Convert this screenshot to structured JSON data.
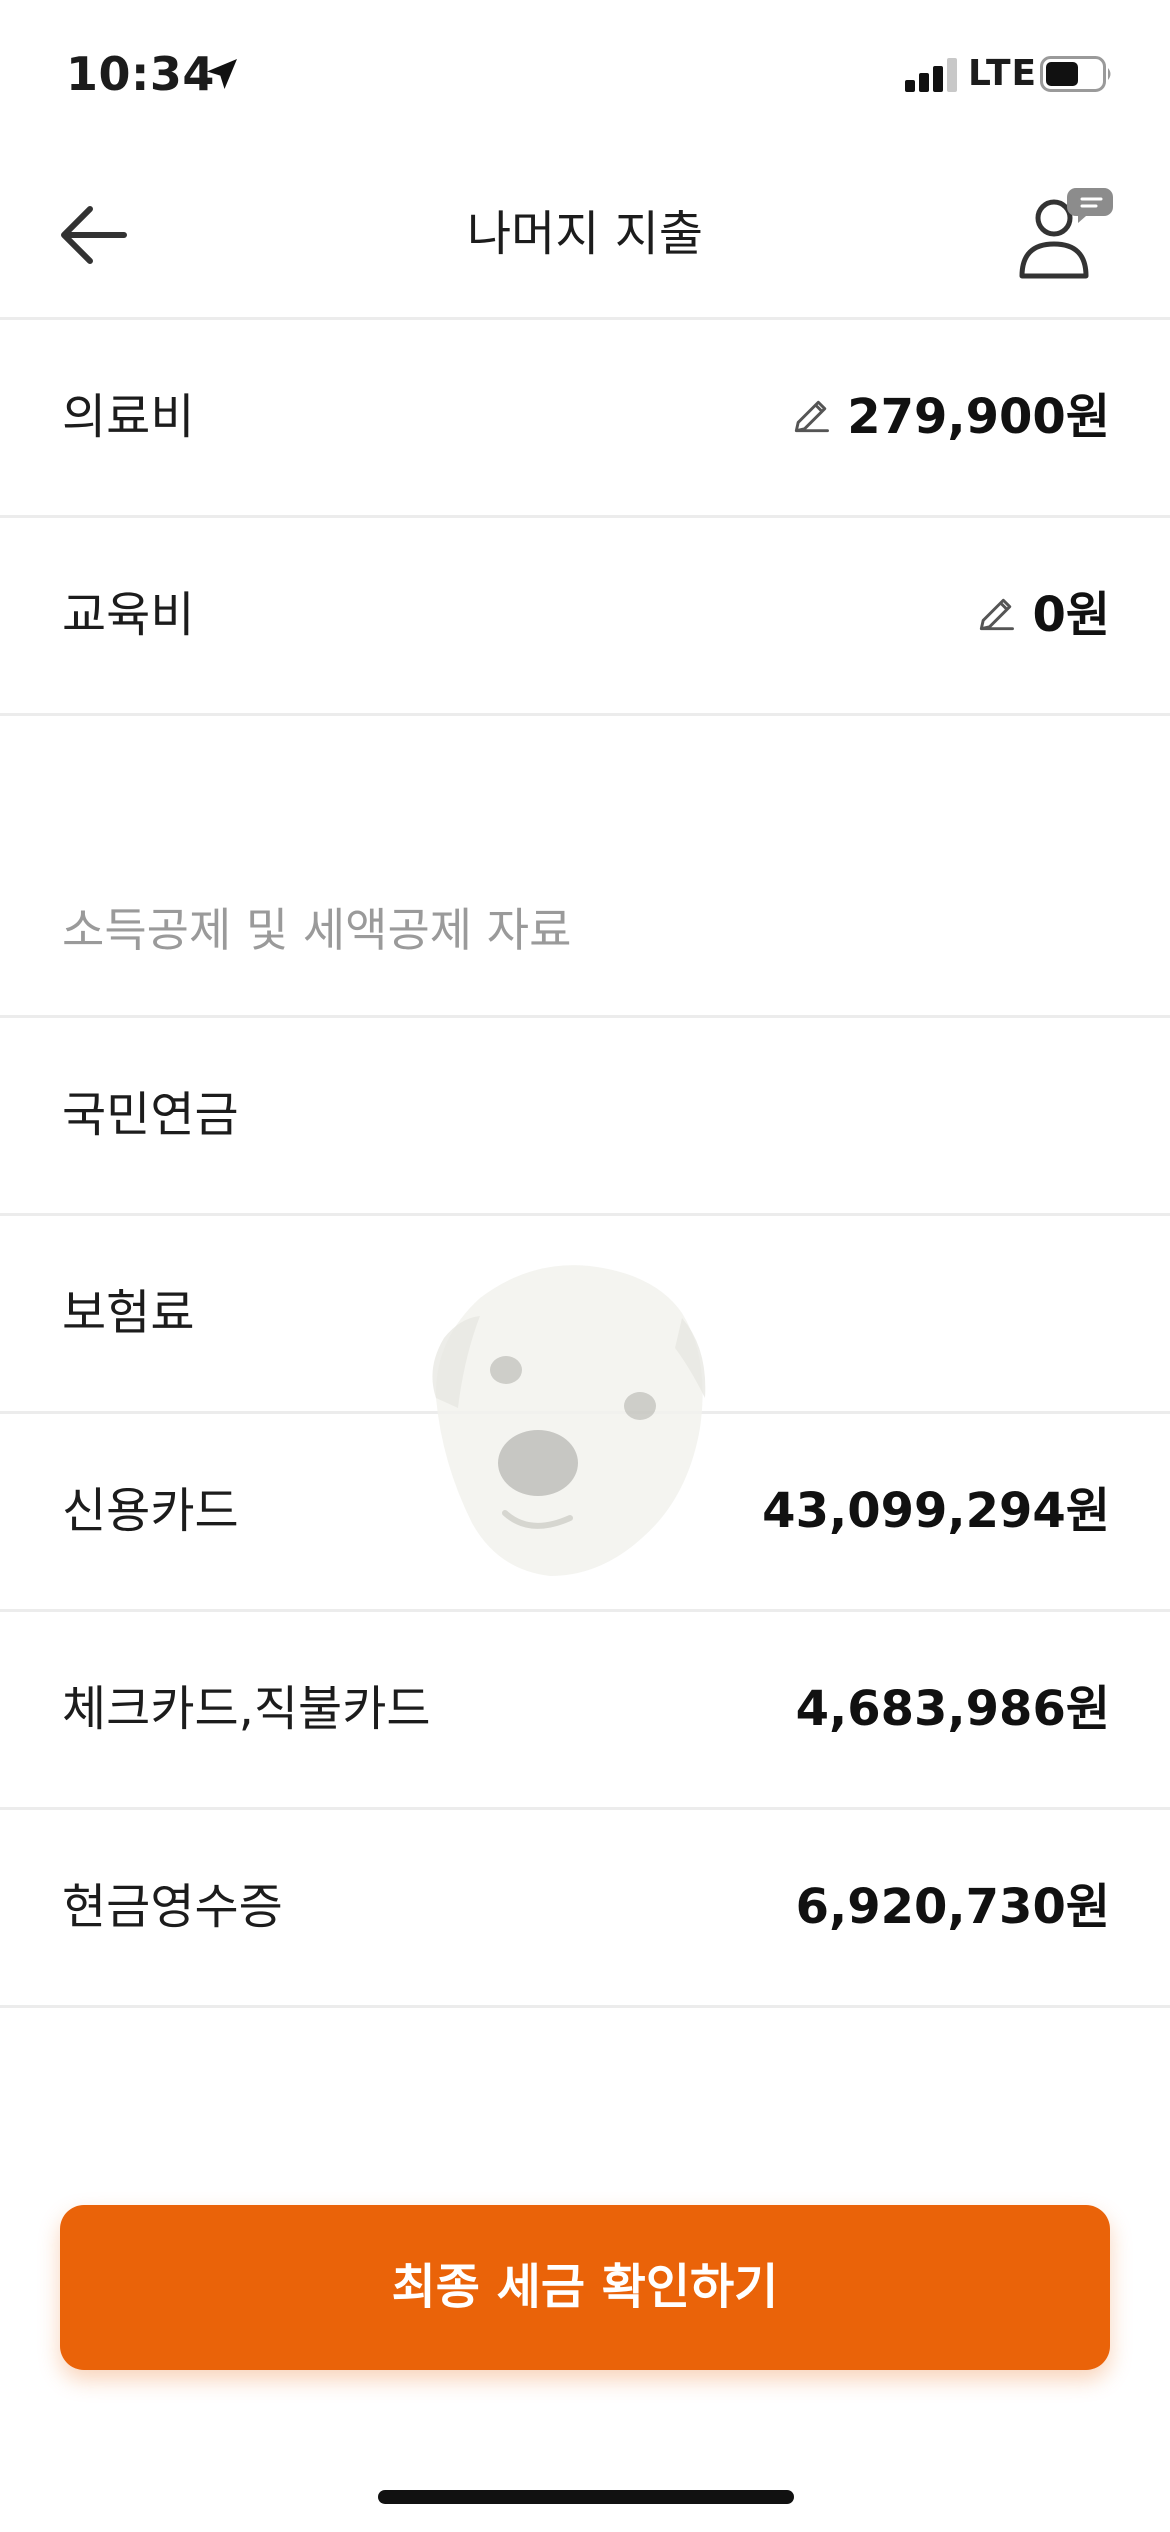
{
  "status_bar": {
    "time": "10:34",
    "network": "LTE",
    "location_icon": "location-arrow-icon",
    "signal_icon": "cellular-signal-icon",
    "battery_icon": "battery-icon"
  },
  "header": {
    "title": "나머지 지출",
    "back_icon": "arrow-left-icon",
    "profile_icon": "user-chat-icon"
  },
  "expense_rows": [
    {
      "label": "의료비",
      "value": "279,900원",
      "editable": true,
      "edit_icon": "pencil-icon"
    },
    {
      "label": "교육비",
      "value": "0원",
      "editable": true,
      "edit_icon": "pencil-icon"
    }
  ],
  "deduction_section": {
    "heading": "소득공제 및 세액공제 자료",
    "rows": [
      {
        "label": "국민연금",
        "value": ""
      },
      {
        "label": "보험료",
        "value": ""
      },
      {
        "label": "신용카드",
        "value": "43,099,294원"
      },
      {
        "label": "체크카드,직불카드",
        "value": "4,683,986원"
      },
      {
        "label": "현금영수증",
        "value": "6,920,730원"
      }
    ]
  },
  "cta": {
    "label": "최종 세금 확인하기"
  },
  "colors": {
    "accent": "#ea6309",
    "divider": "#ececec",
    "muted_text": "#9a9a9a",
    "text": "#1c1c1c"
  }
}
